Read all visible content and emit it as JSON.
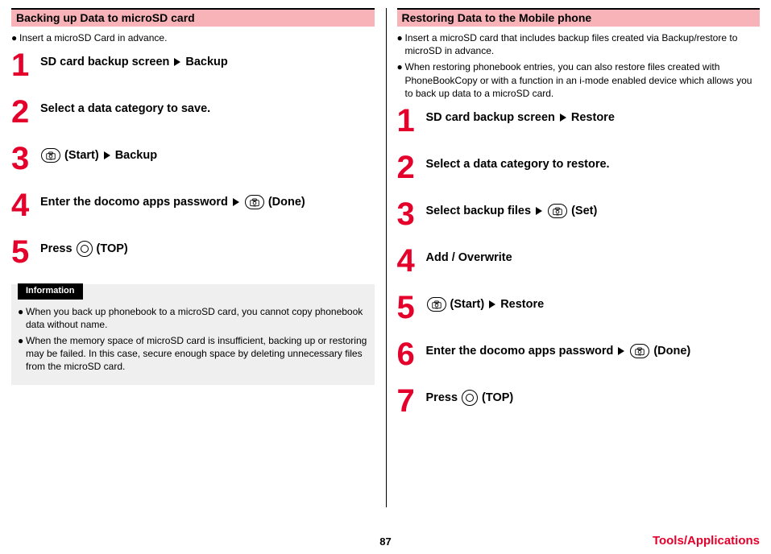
{
  "left": {
    "header": "Backing up Data to microSD card",
    "preBullets": [
      "Insert a microSD Card in advance."
    ],
    "steps": [
      {
        "num": "1",
        "parts": [
          {
            "t": "text",
            "v": "SD card backup screen"
          },
          {
            "t": "tri"
          },
          {
            "t": "text",
            "v": "Backup"
          }
        ]
      },
      {
        "num": "2",
        "parts": [
          {
            "t": "text",
            "v": "Select a data category to save."
          }
        ]
      },
      {
        "num": "3",
        "parts": [
          {
            "t": "camera"
          },
          {
            "t": "text",
            "v": "(Start)"
          },
          {
            "t": "tri"
          },
          {
            "t": "text",
            "v": "Backup"
          }
        ]
      },
      {
        "num": "4",
        "parts": [
          {
            "t": "text",
            "v": "Enter the docomo apps password"
          },
          {
            "t": "tri"
          },
          {
            "t": "camera"
          },
          {
            "t": "text",
            "v": "(Done)"
          }
        ]
      },
      {
        "num": "5",
        "parts": [
          {
            "t": "text",
            "v": "Press"
          },
          {
            "t": "center"
          },
          {
            "t": "text",
            "v": "(TOP)"
          }
        ]
      }
    ],
    "infoLabel": "Information",
    "infoBullets": [
      "When you back up phonebook to a microSD card, you cannot copy phonebook data without name.",
      "When the memory space of microSD card is insufficient, backing up or restoring may be failed. In this case, secure enough space by deleting unnecessary files from the microSD card."
    ]
  },
  "right": {
    "header": "Restoring Data to the Mobile phone",
    "preBullets": [
      "Insert a microSD card that includes backup files created via Backup/restore to microSD in advance.",
      "When restoring phonebook entries, you can also restore files created with PhoneBookCopy or with a function in an i-mode enabled device which allows you to back up data to a microSD card."
    ],
    "steps": [
      {
        "num": "1",
        "parts": [
          {
            "t": "text",
            "v": "SD card backup screen"
          },
          {
            "t": "tri"
          },
          {
            "t": "text",
            "v": "Restore"
          }
        ]
      },
      {
        "num": "2",
        "parts": [
          {
            "t": "text",
            "v": "Select a data category to restore."
          }
        ]
      },
      {
        "num": "3",
        "parts": [
          {
            "t": "text",
            "v": "Select backup files"
          },
          {
            "t": "tri"
          },
          {
            "t": "camera"
          },
          {
            "t": "text",
            "v": "(Set)"
          }
        ]
      },
      {
        "num": "4",
        "parts": [
          {
            "t": "text",
            "v": "Add / Overwrite"
          }
        ]
      },
      {
        "num": "5",
        "parts": [
          {
            "t": "camera"
          },
          {
            "t": "text",
            "v": "(Start)"
          },
          {
            "t": "tri"
          },
          {
            "t": "text",
            "v": "Restore"
          }
        ]
      },
      {
        "num": "6",
        "parts": [
          {
            "t": "text",
            "v": "Enter the docomo apps password"
          },
          {
            "t": "tri"
          },
          {
            "t": "camera"
          },
          {
            "t": "text",
            "v": "(Done)"
          }
        ]
      },
      {
        "num": "7",
        "parts": [
          {
            "t": "text",
            "v": "Press"
          },
          {
            "t": "center"
          },
          {
            "t": "text",
            "v": "(TOP)"
          }
        ]
      }
    ]
  },
  "footer": {
    "page": "87",
    "section": "Tools/Applications"
  }
}
